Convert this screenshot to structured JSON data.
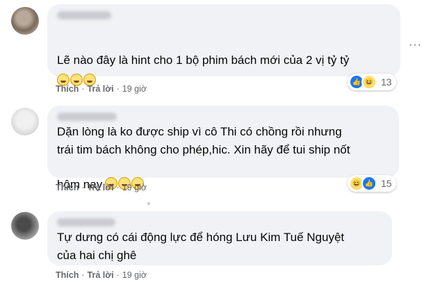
{
  "comments": [
    {
      "text": "Lẽ nào đây là hint cho 1 bộ phim bách mới của 2 vị tỷ tỷ",
      "action_like": "Thích",
      "action_reply": "Trả lời",
      "time": "19 giờ",
      "reaction_count": "13",
      "reactions": [
        "like-icon",
        "haha-icon"
      ]
    },
    {
      "text_line1": "Dặn lòng là ko được ship vì cô Thi có chồng rồi nhưng",
      "text_line2": "trái tim bách không cho phép,hic. Xin hãy để tui ship nốt",
      "text_line3": "hôm nay",
      "action_like": "Thích",
      "action_reply": "Trả lời",
      "time": "19 giờ",
      "reaction_count": "15",
      "reactions": [
        "haha-icon",
        "like-icon"
      ]
    },
    {
      "text_line1": "Tự dưng có cái động lực để hóng Lưu Kim Tuế Nguyệt",
      "text_line2": "của hai chị ghê",
      "action_like": "Thích",
      "action_reply": "Trả lời",
      "time": "19 giờ"
    }
  ],
  "separator": "·",
  "more_glyph": "···"
}
